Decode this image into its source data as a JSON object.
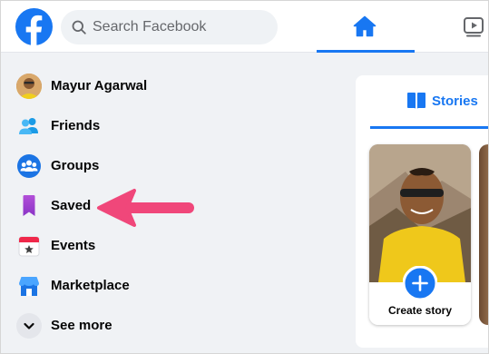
{
  "topbar": {
    "logo_icon": "facebook-logo-icon",
    "search": {
      "placeholder": "Search Facebook",
      "value": "",
      "icon": "search-icon"
    },
    "nav": [
      {
        "name": "home",
        "icon": "home-icon",
        "active": true
      },
      {
        "name": "watch",
        "icon": "video-play-icon",
        "active": false
      }
    ]
  },
  "sidebar": {
    "items": [
      {
        "label": "Mayur Agarwal",
        "icon": "profile-avatar"
      },
      {
        "label": "Friends",
        "icon": "friends-icon"
      },
      {
        "label": "Groups",
        "icon": "groups-icon"
      },
      {
        "label": "Saved",
        "icon": "bookmark-icon"
      },
      {
        "label": "Events",
        "icon": "calendar-star-icon"
      },
      {
        "label": "Marketplace",
        "icon": "shop-icon"
      },
      {
        "label": "See more",
        "icon": "chevron-down-icon"
      }
    ]
  },
  "annotation": {
    "arrow_color": "#f0477a",
    "points_to": "Saved"
  },
  "stories": {
    "tab_label": "Stories",
    "tab_icon": "book-open-icon",
    "create_label": "Create story",
    "plus_icon": "plus-icon"
  },
  "colors": {
    "brand": "#1877f2",
    "page_bg": "#f0f2f5",
    "text": "#050505",
    "secondary_text": "#65676b"
  }
}
